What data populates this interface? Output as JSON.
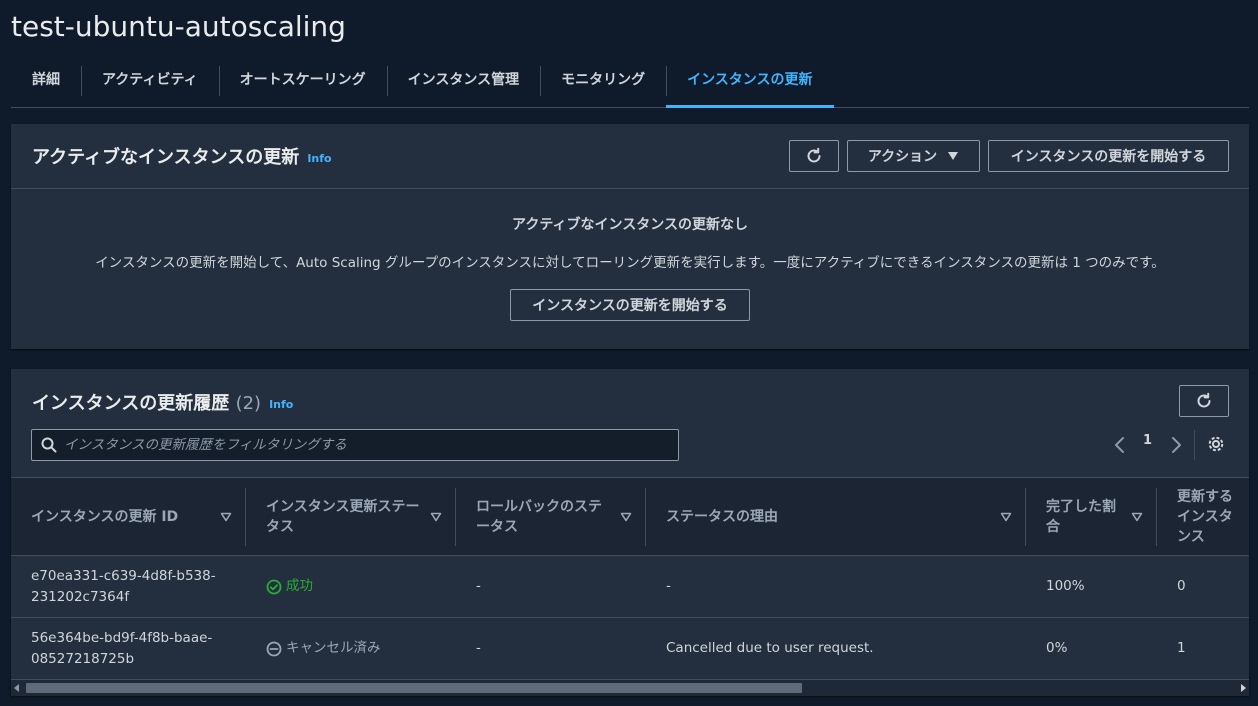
{
  "page": {
    "title": "test-ubuntu-autoscaling"
  },
  "tabs": [
    {
      "label": "詳細"
    },
    {
      "label": "アクティビティ"
    },
    {
      "label": "オートスケーリング"
    },
    {
      "label": "インスタンス管理"
    },
    {
      "label": "モニタリング"
    },
    {
      "label": "インスタンスの更新"
    }
  ],
  "active_refresh": {
    "heading": "アクティブなインスタンスの更新",
    "info": "Info",
    "actions_label": "アクション",
    "start_label": "インスタンスの更新を開始する",
    "empty_title": "アクティブなインスタンスの更新なし",
    "empty_description": "インスタンスの更新を開始して、Auto Scaling グループのインスタンスに対してローリング更新を実行します。一度にアクティブにできるインスタンスの更新は 1 つのみです。",
    "empty_start_label": "インスタンスの更新を開始する"
  },
  "history": {
    "heading": "インスタンスの更新履歴",
    "count": "(2)",
    "info": "Info",
    "search_placeholder": "インスタンスの更新履歴をフィルタリングする",
    "page_number": "1",
    "columns": [
      "インスタンスの更新 ID",
      "インスタンス更新ステータス",
      "ロールバックのステータス",
      "ステータスの理由",
      "完了した割合",
      "更新するインスタンス"
    ],
    "rows": [
      {
        "id_line1": "e70ea331-c639-4d8f-b538-",
        "id_line2": "231202c7364f",
        "status": "成功",
        "rollback": "-",
        "reason": "-",
        "percent": "100%",
        "to_update": "0"
      },
      {
        "id_line1": "56e364be-bd9f-4f8b-baae-",
        "id_line2": "08527218725b",
        "status": "キャンセル済み",
        "rollback": "-",
        "reason": "Cancelled due to user request.",
        "percent": "0%",
        "to_update": "1"
      }
    ]
  },
  "colors": {
    "background": "#0f1b2a",
    "panel": "#232f3e",
    "accent": "#42b4ff",
    "success": "#29ad32",
    "muted": "#9ba7b6"
  }
}
